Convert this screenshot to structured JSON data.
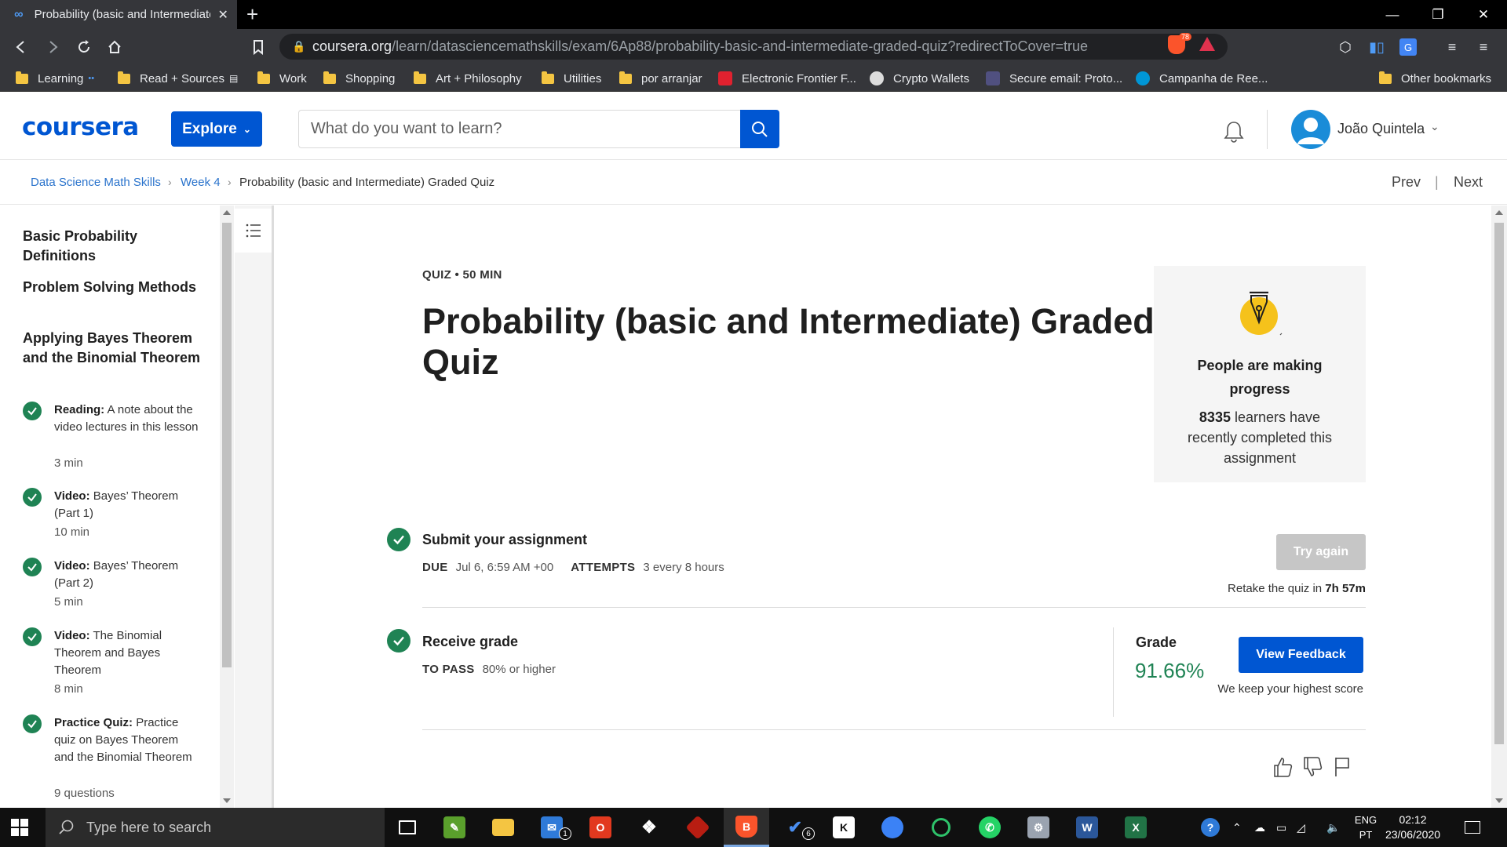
{
  "browser": {
    "tab_title": "Probability (basic and Intermediate) Graded Quiz",
    "url_domain": "coursera.org",
    "url_path": "/learn/datasciencemathskills/exam/6Ap88/probability-basic-and-intermediate-graded-quiz?redirectToCover=true",
    "brave_badge": "78",
    "bookmarks": [
      {
        "label": "Learning",
        "icon": "folder-icon"
      },
      {
        "label": "Read + Sources",
        "icon": "folder-icon"
      },
      {
        "label": "Work",
        "icon": "folder-icon"
      },
      {
        "label": "Shopping",
        "icon": "folder-icon"
      },
      {
        "label": "Art + Philosophy",
        "icon": "folder-icon"
      },
      {
        "label": "Utilities",
        "icon": "folder-icon"
      },
      {
        "label": "por arranjar",
        "icon": "folder-icon"
      },
      {
        "label": "Electronic Frontier F...",
        "icon": "eff-icon"
      },
      {
        "label": "Crypto Wallets",
        "icon": "globe-icon"
      },
      {
        "label": "Secure email: Proto...",
        "icon": "protonmail-icon"
      },
      {
        "label": "Campanha de Ree...",
        "icon": "hp-icon"
      },
      {
        "label": "Other bookmarks",
        "icon": "folder-icon"
      }
    ]
  },
  "header": {
    "logo": "coursera",
    "explore_label": "Explore",
    "search_placeholder": "What do you want to learn?",
    "username": "João Quintela"
  },
  "breadcrumb": {
    "items": [
      "Data Science Math Skills",
      "Week 4",
      "Probability (basic and Intermediate) Graded Quiz"
    ],
    "prev": "Prev",
    "next": "Next"
  },
  "sidebar": {
    "headings": [
      "Basic Probability Definitions",
      "Problem Solving Methods",
      "Applying Bayes Theorem and the Binomial Theorem"
    ],
    "items": [
      {
        "type": "Reading:",
        "title": "A note about the video lectures in this lesson",
        "meta": "3 min"
      },
      {
        "type": "Video:",
        "title": "Bayes’ Theorem (Part 1)",
        "meta": "10 min"
      },
      {
        "type": "Video:",
        "title": "Bayes’ Theorem (Part 2)",
        "meta": "5 min"
      },
      {
        "type": "Video:",
        "title": "The Binomial Theorem and Bayes Theorem",
        "meta": "8 min"
      },
      {
        "type": "Practice Quiz:",
        "title": "Practice quiz on Bayes Theorem and the Binomial Theorem",
        "meta": "9 questions"
      }
    ]
  },
  "main": {
    "kicker": "QUIZ • 50 MIN",
    "title": "Probability (basic and Intermediate) Graded Quiz",
    "progress_card": {
      "title": "People are making progress",
      "count": "8335",
      "body": "learners have recently completed this assignment"
    },
    "submit": {
      "title": "Submit your assignment",
      "due_label": "DUE",
      "due_value": "Jul 6, 6:59 AM +00",
      "attempts_label": "ATTEMPTS",
      "attempts_value": "3 every 8 hours",
      "try_again": "Try again",
      "retake_text": "Retake the quiz in",
      "retake_time": "7h 57m"
    },
    "receive": {
      "title": "Receive grade",
      "pass_label": "TO PASS",
      "pass_value": "80% or higher",
      "grade_label": "Grade",
      "grade_value": "91.66%",
      "view_feedback": "View Feedback",
      "keep_text": "We keep your highest score"
    }
  },
  "taskbar": {
    "search_placeholder": "Type here to search",
    "lang_top": "ENG",
    "lang_bottom": "PT",
    "time": "02:12",
    "date": "23/06/2020",
    "mail_badge": "1",
    "todo_badge": "6"
  }
}
